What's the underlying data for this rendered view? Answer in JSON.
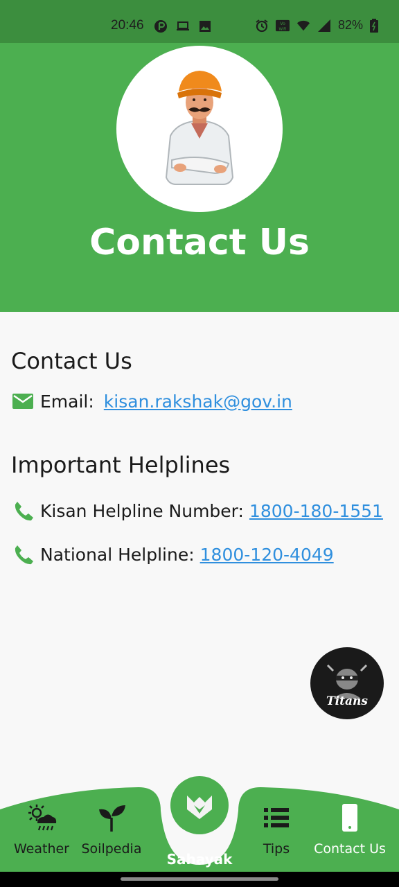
{
  "status_bar": {
    "time": "20:46",
    "battery": "82%",
    "icons_left": [
      "app-notification-icon",
      "laptop-icon",
      "image-icon"
    ],
    "icons_right": [
      "alarm-icon",
      "vowifi-icon",
      "wifi-icon",
      "signal-icon",
      "battery-icon"
    ]
  },
  "header": {
    "title": "Contact Us",
    "avatar_icon": "farmer-avatar-icon",
    "background": "#4caf50"
  },
  "contact": {
    "heading": "Contact Us",
    "email_label": "Email:",
    "email_value": "kisan.rakshak@gov.in"
  },
  "helplines": {
    "heading": "Important Helplines",
    "items": [
      {
        "label": "Kisan Helpline Number:",
        "number": "1800-180-1551"
      },
      {
        "label": "National Helpline:",
        "number": "1800-120-4049"
      }
    ]
  },
  "floating_badge": {
    "label": "Titans"
  },
  "bottom_nav": {
    "items": [
      {
        "label": "Weather",
        "icon": "weather-icon"
      },
      {
        "label": "Soilpedia",
        "icon": "sprout-icon"
      },
      {
        "label": "Sahayak",
        "icon": "fox-logo-icon"
      },
      {
        "label": "Tips",
        "icon": "list-icon"
      },
      {
        "label": "Contact Us",
        "icon": "phone-icon"
      }
    ]
  },
  "colors": {
    "primary_green": "#4caf50",
    "status_bar_green": "#3c8e3e",
    "link_blue": "#2f8fde",
    "icon_green": "#4caf50"
  }
}
